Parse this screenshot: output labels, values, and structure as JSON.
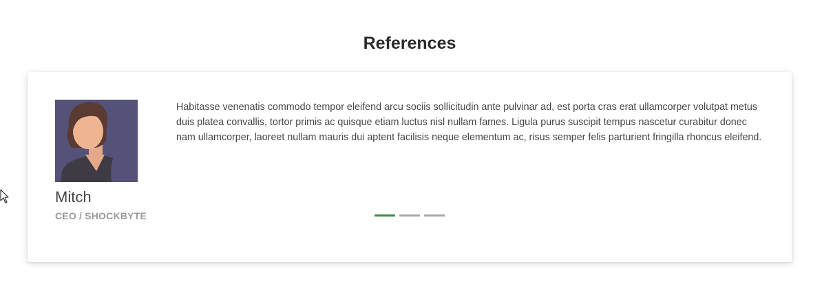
{
  "section": {
    "title": "References"
  },
  "testimonial": {
    "name": "Mitch",
    "role": "CEO / SHOCKBYTE",
    "quote": "Habitasse venenatis commodo tempor eleifend arcu sociis sollicitudin ante pulvinar ad, est porta cras erat ullamcorper volutpat metus duis platea convallis, tortor primis ac quisque etiam luctus nisl nullam fames. Ligula purus suscipit tempus nascetur curabitur donec nam ullamcorper, laoreet nullam mauris dui aptent facilisis neque elementum ac, risus semper felis parturient fringilla rhoncus eleifend.",
    "avatar_icon": "person-avatar-icon"
  },
  "pager": {
    "count": 3,
    "active_index": 0
  },
  "colors": {
    "accent": "#3a8a3e",
    "inactive_dot": "#a8a8a8",
    "avatar_bg": "#55527a"
  }
}
